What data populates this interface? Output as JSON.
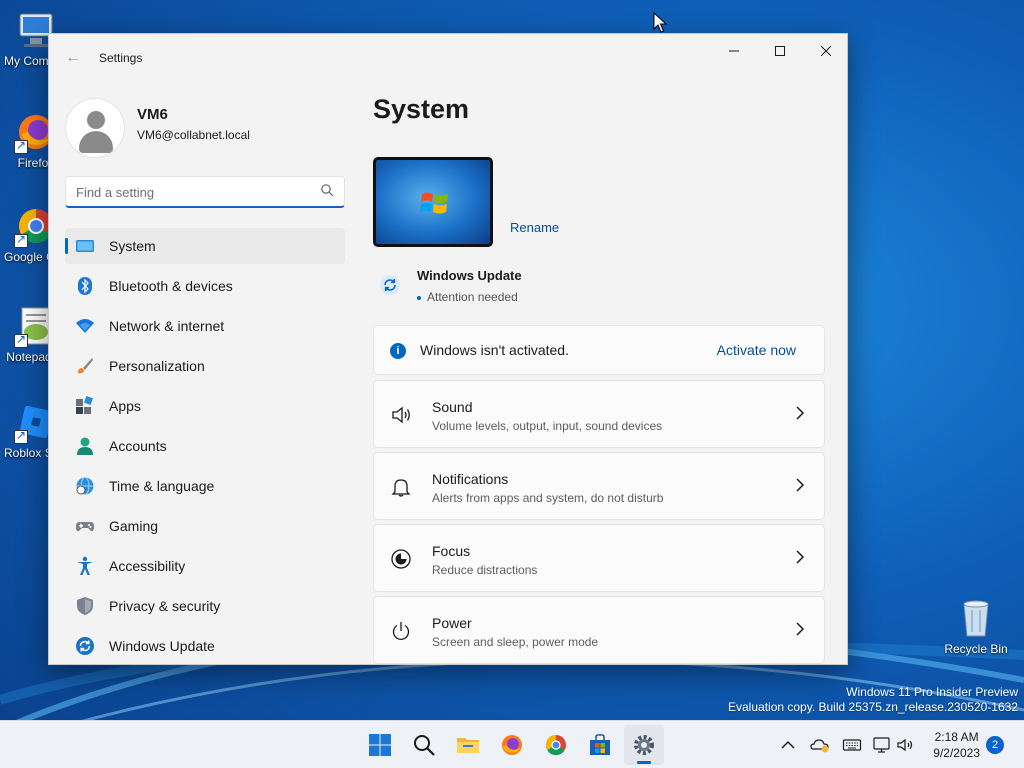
{
  "desktop": {
    "icons": [
      {
        "label": "My Computer",
        "icon": "computer-icon"
      },
      {
        "label": "Firefox",
        "icon": "firefox-icon"
      },
      {
        "label": "Google Chrome",
        "icon": "chrome-icon"
      },
      {
        "label": "Notepad++",
        "icon": "notepad-plus-plus-icon"
      },
      {
        "label": "Roblox Studio",
        "icon": "roblox-studio-icon"
      },
      {
        "label": "Recycle Bin",
        "icon": "recycle-bin-icon"
      }
    ],
    "watermark": {
      "line1": "Windows 11 Pro Insider Preview",
      "line2": "Evaluation copy. Build 25375.zn_release.230520-1632"
    }
  },
  "window": {
    "title": "Settings",
    "controls": {
      "minimize": "minimize-icon",
      "maximize": "maximize-icon",
      "close": "close-icon"
    }
  },
  "profile": {
    "name": "VM6",
    "email": "VM6@collabnet.local"
  },
  "search": {
    "placeholder": "Find a setting"
  },
  "sidebar": {
    "items": [
      {
        "label": "System",
        "icon": "system-icon",
        "active": true
      },
      {
        "label": "Bluetooth & devices",
        "icon": "bluetooth-icon"
      },
      {
        "label": "Network & internet",
        "icon": "wifi-icon"
      },
      {
        "label": "Personalization",
        "icon": "brush-icon"
      },
      {
        "label": "Apps",
        "icon": "apps-icon"
      },
      {
        "label": "Accounts",
        "icon": "accounts-icon"
      },
      {
        "label": "Time & language",
        "icon": "globe-clock-icon"
      },
      {
        "label": "Gaming",
        "icon": "gamepad-icon"
      },
      {
        "label": "Accessibility",
        "icon": "accessibility-icon"
      },
      {
        "label": "Privacy & security",
        "icon": "shield-icon"
      },
      {
        "label": "Windows Update",
        "icon": "windows-update-icon"
      }
    ]
  },
  "main": {
    "title": "System",
    "rename_label": "Rename",
    "windows_update": {
      "title": "Windows Update",
      "status": "Attention needed"
    },
    "activation": {
      "message": "Windows isn't activated.",
      "action": "Activate now"
    },
    "settings": [
      {
        "title": "Sound",
        "subtitle": "Volume levels, output, input, sound devices",
        "icon": "speaker-icon"
      },
      {
        "title": "Notifications",
        "subtitle": "Alerts from apps and system, do not disturb",
        "icon": "bell-icon"
      },
      {
        "title": "Focus",
        "subtitle": "Reduce distractions",
        "icon": "focus-icon"
      },
      {
        "title": "Power",
        "subtitle": "Screen and sleep, power mode",
        "icon": "power-icon"
      }
    ]
  },
  "taskbar": {
    "apps": [
      "start-icon",
      "search-icon",
      "file-explorer-icon",
      "firefox-icon",
      "chrome-icon",
      "microsoft-store-icon",
      "settings-icon"
    ],
    "clock": {
      "time": "2:18 AM",
      "date": "9/2/2023"
    },
    "notification_count": "2"
  },
  "colors": {
    "accent": "#0067c0",
    "link": "#004f9e",
    "window_bg": "#f3f3f3",
    "card_bg": "#fbfbfb"
  }
}
